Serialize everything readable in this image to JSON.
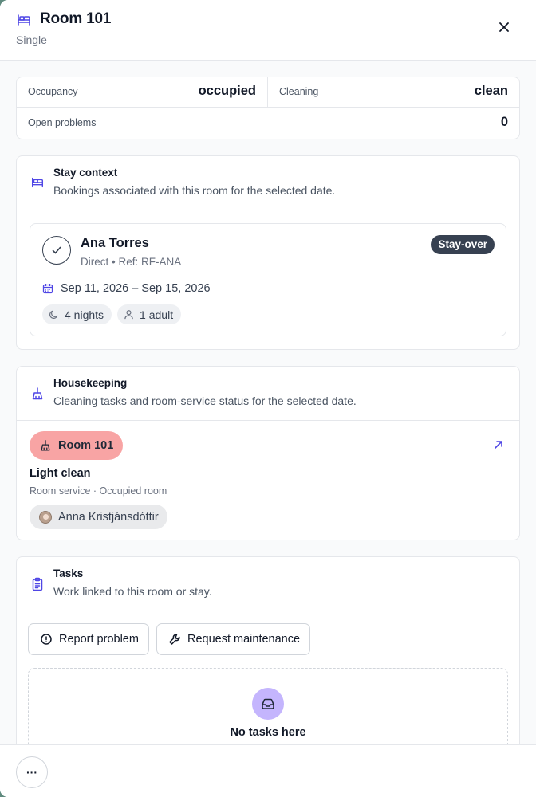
{
  "header": {
    "title": "Room 101",
    "subtitle": "Single",
    "icon": "bed-icon"
  },
  "stats": {
    "occupancy_label": "Occupancy",
    "occupancy_value": "occupied",
    "cleaning_label": "Cleaning",
    "cleaning_value": "clean",
    "problems_label": "Open problems",
    "problems_value": "0"
  },
  "stay": {
    "title": "Stay context",
    "description": "Bookings associated with this room for the selected date.",
    "booking": {
      "guest": "Ana Torres",
      "meta": "Direct • Ref: RF-ANA",
      "badge": "Stay-over",
      "dates": "Sep 11, 2026 – Sep 15, 2026",
      "nights": "4 nights",
      "guests": "1 adult"
    }
  },
  "housekeeping": {
    "title": "Housekeeping",
    "description": "Cleaning tasks and room-service status for the selected date.",
    "room_badge": "Room 101",
    "room_badge_color": "#f8a4a4",
    "task_title": "Light clean",
    "task_meta": "Room service · Occupied room",
    "assignee": "Anna Kristjánsdóttir"
  },
  "tasks": {
    "title": "Tasks",
    "description": "Work linked to this room or stay.",
    "report_label": "Report problem",
    "maintenance_label": "Request maintenance",
    "empty_text": "No tasks here"
  },
  "footer": {
    "more_label": "···"
  },
  "colors": {
    "accent": "#4f46e5",
    "badge_dark": "#374151",
    "empty_icon_bg": "#c4b5fd"
  }
}
